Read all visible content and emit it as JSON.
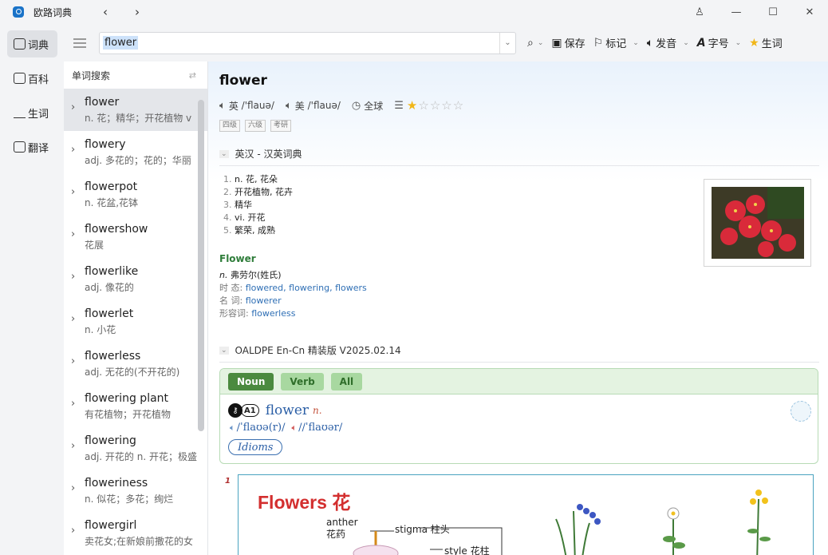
{
  "window": {
    "title": "欧路词典",
    "back": "‹",
    "forward": "›",
    "user": "♙",
    "minimize": "—",
    "maximize": "☐",
    "close": "✕"
  },
  "nav": {
    "items": [
      {
        "label": "词典",
        "icon": "dictionary-icon"
      },
      {
        "label": "百科",
        "icon": "encyclopedia-icon"
      },
      {
        "label": "生词",
        "icon": "vocabulary-icon"
      },
      {
        "label": "翻译",
        "icon": "translate-icon"
      }
    ]
  },
  "toolbar": {
    "search_value": "flower",
    "save": "保存",
    "mark": "标记",
    "pronounce": "发音",
    "font": "字号",
    "vocab": "生词"
  },
  "sidebar": {
    "title": "单词搜索",
    "items": [
      {
        "word": "flower",
        "def": "n. 花；精华；开花植物 v"
      },
      {
        "word": "flowery",
        "def": "adj. 多花的；花的；华丽"
      },
      {
        "word": "flowerpot",
        "def": "n. 花盆,花钵"
      },
      {
        "word": "flowershow",
        "def": "花展"
      },
      {
        "word": "flowerlike",
        "def": "adj. 像花的"
      },
      {
        "word": "flowerlet",
        "def": "n. 小花"
      },
      {
        "word": "flowerless",
        "def": "adj. 无花的(不开花的)"
      },
      {
        "word": "flowering plant",
        "def": "有花植物；开花植物"
      },
      {
        "word": "flowering",
        "def": "adj. 开花的 n. 开花；极盛"
      },
      {
        "word": "floweriness",
        "def": "n. 似花；多花；绚烂"
      },
      {
        "word": "flowergirl",
        "def": "卖花女;在新娘前撒花的女"
      }
    ]
  },
  "entry": {
    "headword": "flower",
    "uk_label": "英",
    "uk_ipa": "/'flauə/",
    "us_label": "美",
    "us_ipa": "/'flauə/",
    "global": "全球",
    "rating": 1,
    "tags": [
      "四级",
      "六级",
      "考研"
    ],
    "dict1": {
      "name": "英汉 - 汉英词典",
      "defs": [
        {
          "n": "1.",
          "text": "n. 花, 花朵"
        },
        {
          "n": "2.",
          "text": "开花植物, 花卉"
        },
        {
          "n": "3.",
          "text": "精华"
        },
        {
          "n": "4.",
          "text": "vi. 开花"
        },
        {
          "n": "5.",
          "text": "繁荣, 成熟"
        }
      ]
    },
    "proper": {
      "title": "Flower",
      "pos": "n.",
      "gloss": "弗劳尔(姓氏)",
      "tense_label": "时 态:",
      "tense_forms": "flowered, flowering, flowers",
      "noun_label": "名 词:",
      "noun_form": "flowerer",
      "adj_label": "形容词:",
      "adj_form": "flowerless"
    },
    "dict2": {
      "name": "OALDPE En-Cn 精装版 V2025.02.14",
      "tabs": [
        "Noun",
        "Verb",
        "All"
      ],
      "key_badge": "A1",
      "word": "flower",
      "pos": "n.",
      "br_ipa": "/ˈflaʊə(r)/",
      "sep": "/",
      "am_ipa": "/ˈflaʊər/",
      "idioms": "Idioms"
    },
    "illustration": {
      "sense": "1",
      "title": "Flowers",
      "title_zh": "花",
      "labels": [
        {
          "en": "anther",
          "zh": "花药"
        },
        {
          "en": "stigma",
          "zh": "柱头"
        },
        {
          "en": "style",
          "zh": "花柱"
        }
      ]
    }
  },
  "colors": {
    "accent": "#1a73c8",
    "green_tab": "#4b8a3f",
    "link": "#2f6fb5",
    "illus_title": "#d32f2f"
  }
}
